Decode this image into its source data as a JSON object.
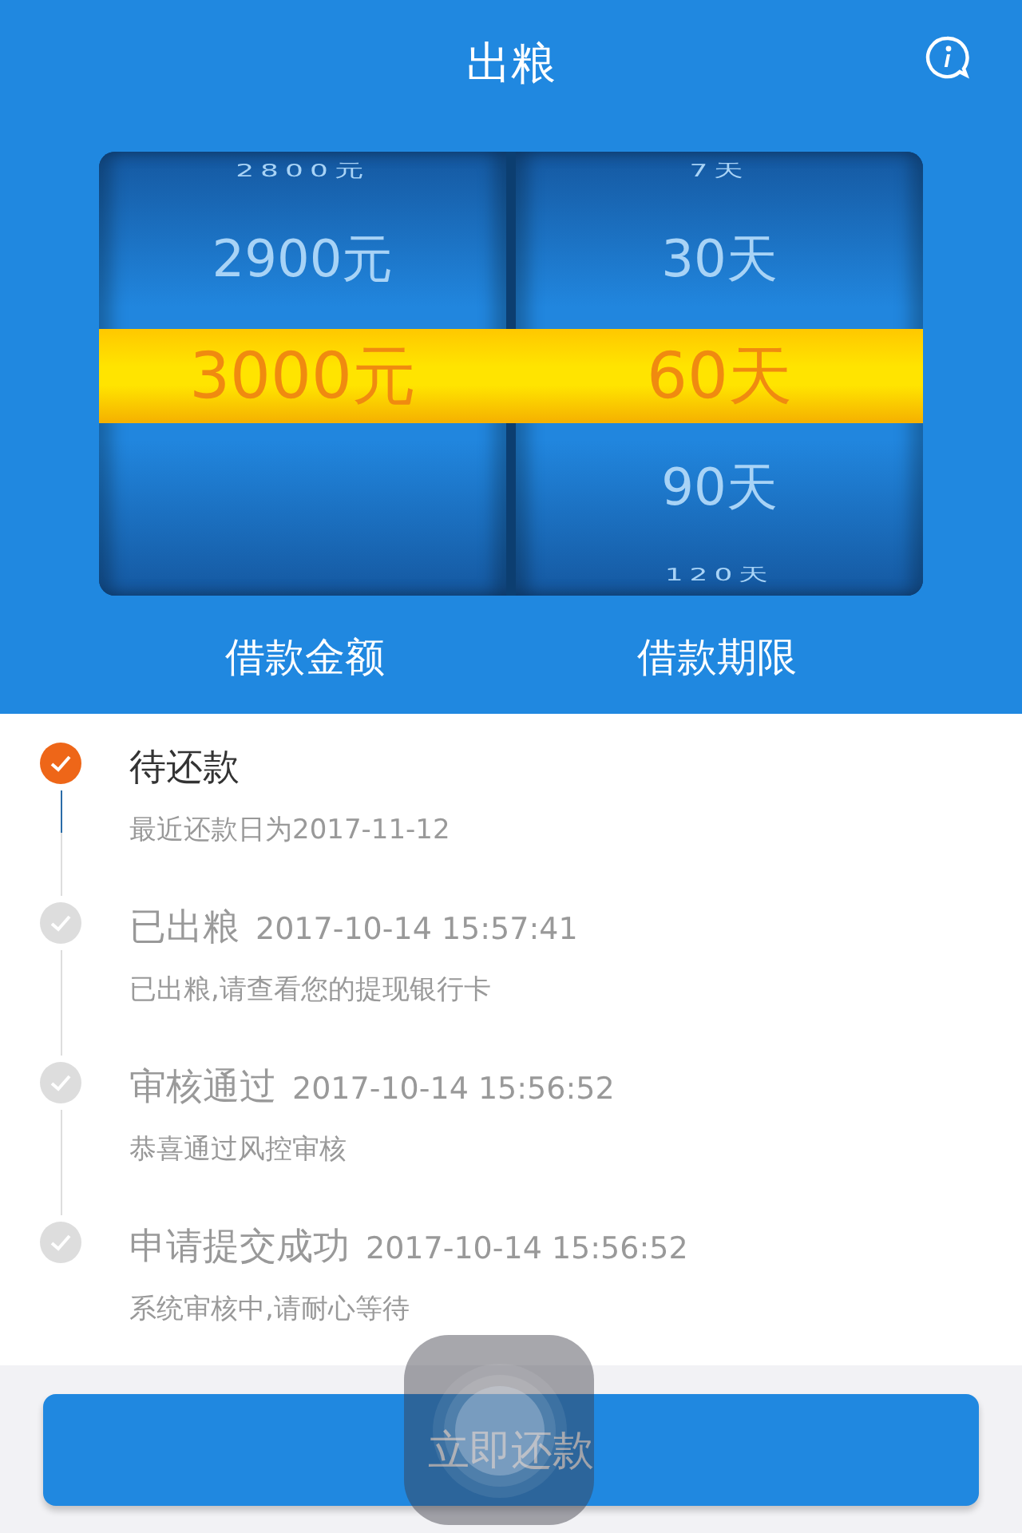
{
  "header": {
    "title": "出粮"
  },
  "wheels": [
    {
      "label": "借款金额",
      "options": [
        {
          "text": "2800元",
          "selected": false
        },
        {
          "text": "2900元",
          "selected": false
        },
        {
          "text": "3000元",
          "selected": true
        }
      ]
    },
    {
      "label": "借款期限",
      "options": [
        {
          "text": "7天",
          "selected": false
        },
        {
          "text": "30天",
          "selected": false
        },
        {
          "text": "60天",
          "selected": true
        },
        {
          "text": "90天",
          "selected": false
        },
        {
          "text": "120天",
          "selected": false
        }
      ]
    }
  ],
  "steps": [
    {
      "title": "待还款",
      "note": "最近还款日为2017-11-12",
      "current": true
    },
    {
      "title": "已出粮",
      "time": "2017-10-14 15:57:41",
      "note": "已出粮,请查看您的提现银行卡",
      "current": false
    },
    {
      "title": "审核通过",
      "time": "2017-10-14 15:56:52",
      "note": "恭喜通过风控审核",
      "current": false
    },
    {
      "title": "申请提交成功",
      "time": "2017-10-14 15:56:52",
      "note": "系统审核中,请耐心等待",
      "current": false
    }
  ],
  "action_button": {
    "label": "立即还款"
  }
}
